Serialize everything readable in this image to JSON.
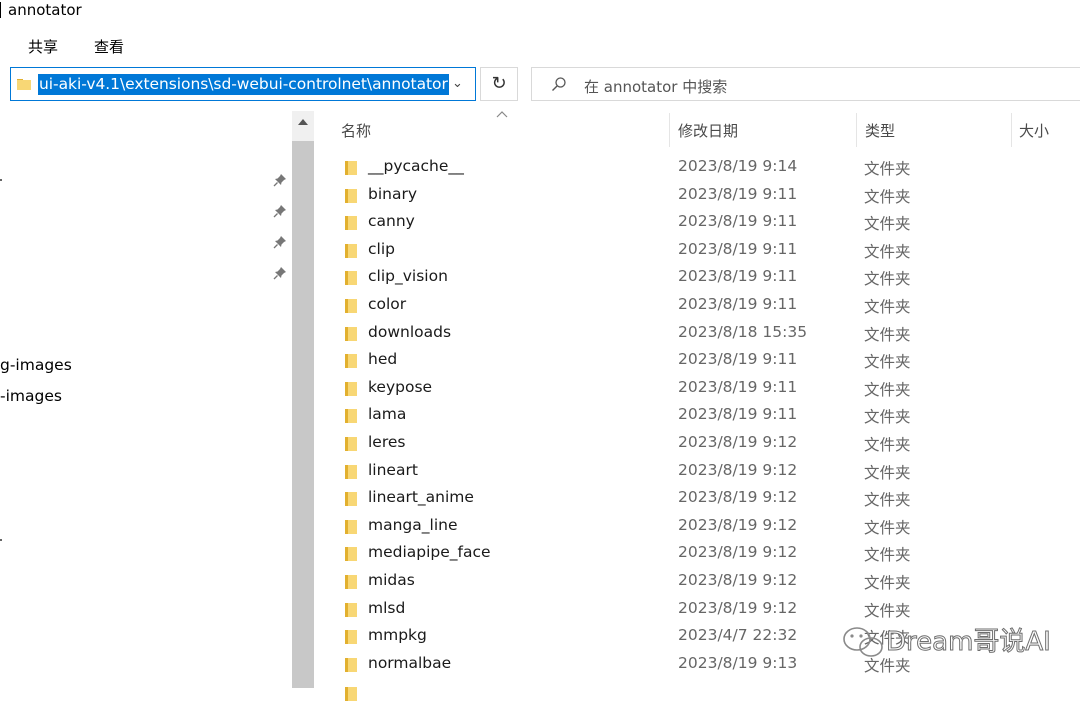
{
  "window": {
    "title": "annotator"
  },
  "ribbon": {
    "tabs": [
      "共享",
      "查看"
    ]
  },
  "address": {
    "path": "ui-aki-v4.1\\extensions\\sd-webui-controlnet\\annotator",
    "icon": "folder-icon"
  },
  "search": {
    "placeholder": "在 annotator 中搜索",
    "icon": "search-icon"
  },
  "nav": {
    "visible_labels": [
      "g-images",
      "-images"
    ]
  },
  "columns": {
    "name": "名称",
    "date": "修改日期",
    "type": "类型",
    "size": "大小"
  },
  "files": [
    {
      "name": "__pycache__",
      "date": "2023/8/19 9:14",
      "type": "文件夹"
    },
    {
      "name": "binary",
      "date": "2023/8/19 9:11",
      "type": "文件夹"
    },
    {
      "name": "canny",
      "date": "2023/8/19 9:11",
      "type": "文件夹"
    },
    {
      "name": "clip",
      "date": "2023/8/19 9:11",
      "type": "文件夹"
    },
    {
      "name": "clip_vision",
      "date": "2023/8/19 9:11",
      "type": "文件夹"
    },
    {
      "name": "color",
      "date": "2023/8/19 9:11",
      "type": "文件夹"
    },
    {
      "name": "downloads",
      "date": "2023/8/18 15:35",
      "type": "文件夹"
    },
    {
      "name": "hed",
      "date": "2023/8/19 9:11",
      "type": "文件夹"
    },
    {
      "name": "keypose",
      "date": "2023/8/19 9:11",
      "type": "文件夹"
    },
    {
      "name": "lama",
      "date": "2023/8/19 9:11",
      "type": "文件夹"
    },
    {
      "name": "leres",
      "date": "2023/8/19 9:12",
      "type": "文件夹"
    },
    {
      "name": "lineart",
      "date": "2023/8/19 9:12",
      "type": "文件夹"
    },
    {
      "name": "lineart_anime",
      "date": "2023/8/19 9:12",
      "type": "文件夹"
    },
    {
      "name": "manga_line",
      "date": "2023/8/19 9:12",
      "type": "文件夹"
    },
    {
      "name": "mediapipe_face",
      "date": "2023/8/19 9:12",
      "type": "文件夹"
    },
    {
      "name": "midas",
      "date": "2023/8/19 9:12",
      "type": "文件夹"
    },
    {
      "name": "mlsd",
      "date": "2023/8/19 9:12",
      "type": "文件夹"
    },
    {
      "name": "mmpkg",
      "date": "2023/4/7 22:32",
      "type": "文件夹"
    },
    {
      "name": "normalbae",
      "date": "2023/8/19 9:13",
      "type": "文件夹"
    }
  ],
  "watermark": {
    "text": "Dream哥说AI"
  },
  "colors": {
    "selection": "#0078d7",
    "folder_yellow": "#f8d775",
    "folder_dark": "#e2b02f",
    "scrollbar_thumb": "#c8c8c8"
  }
}
